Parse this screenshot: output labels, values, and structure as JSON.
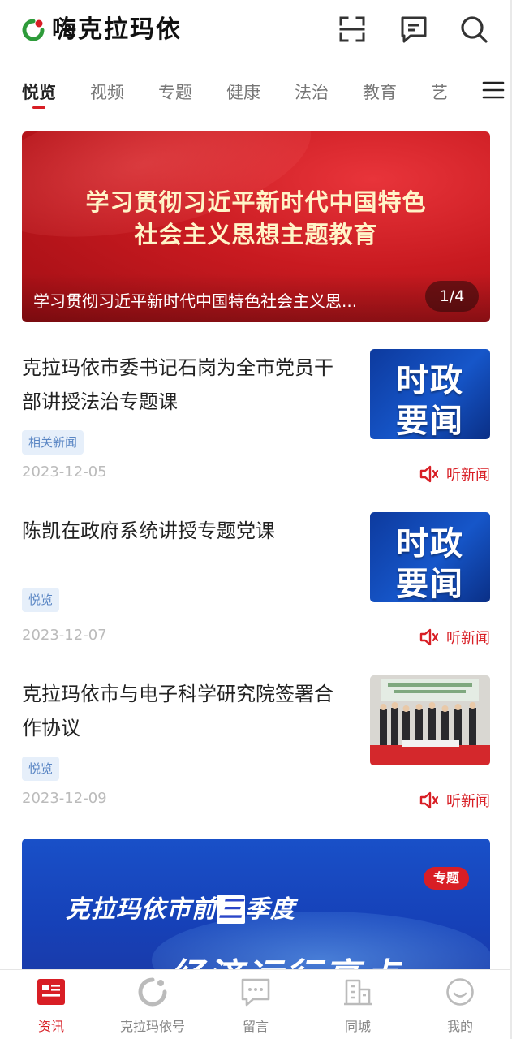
{
  "app": {
    "title": "嗨克拉玛依",
    "brand_red": "#d81e25",
    "brand_green": "#2e9b3a"
  },
  "header": {
    "icons": [
      "scan-icon",
      "message-icon",
      "search-icon"
    ]
  },
  "tabs": [
    {
      "label": "悦览",
      "active": true
    },
    {
      "label": "视频",
      "active": false
    },
    {
      "label": "专题",
      "active": false
    },
    {
      "label": "健康",
      "active": false
    },
    {
      "label": "法治",
      "active": false
    },
    {
      "label": "教育",
      "active": false
    },
    {
      "label": "艺",
      "active": false
    }
  ],
  "banner": {
    "headline_line1": "学习贯彻习近平新时代中国特色",
    "headline_line2": "社会主义思想主题教育",
    "caption": "学习贯彻习近平新时代中国特色社会主义思...",
    "counter": "1/4"
  },
  "news": [
    {
      "title": "克拉玛依市委书记石岗为全市党员干部讲授法治专题课",
      "tag": "相关新闻",
      "date": "2023-12-05",
      "listen_label": "听新闻",
      "thumb": {
        "type": "text",
        "line1": "时政",
        "line2": "要闻"
      }
    },
    {
      "title": "陈凯在政府系统讲授专题党课",
      "tag": "悦览",
      "date": "2023-12-07",
      "listen_label": "听新闻",
      "thumb": {
        "type": "text",
        "line1": "时政",
        "line2": "要闻"
      }
    },
    {
      "title": "克拉玛依市与电子科学研究院签署合作协议",
      "tag": "悦览",
      "date": "2023-12-09",
      "listen_label": "听新闻",
      "thumb": {
        "type": "photo"
      }
    }
  ],
  "special": {
    "badge": "专题",
    "title_prefix": "克拉玛依市前",
    "title_highlight": "三",
    "title_suffix": "季度",
    "subtitle": "经济运行亮点"
  },
  "bottom_nav": [
    {
      "label": "资讯",
      "icon": "news-icon",
      "active": true
    },
    {
      "label": "克拉玛依号",
      "icon": "karamay-account-icon",
      "active": false
    },
    {
      "label": "留言",
      "icon": "comment-icon",
      "active": false
    },
    {
      "label": "同城",
      "icon": "city-icon",
      "active": false
    },
    {
      "label": "我的",
      "icon": "profile-icon",
      "active": false
    }
  ]
}
